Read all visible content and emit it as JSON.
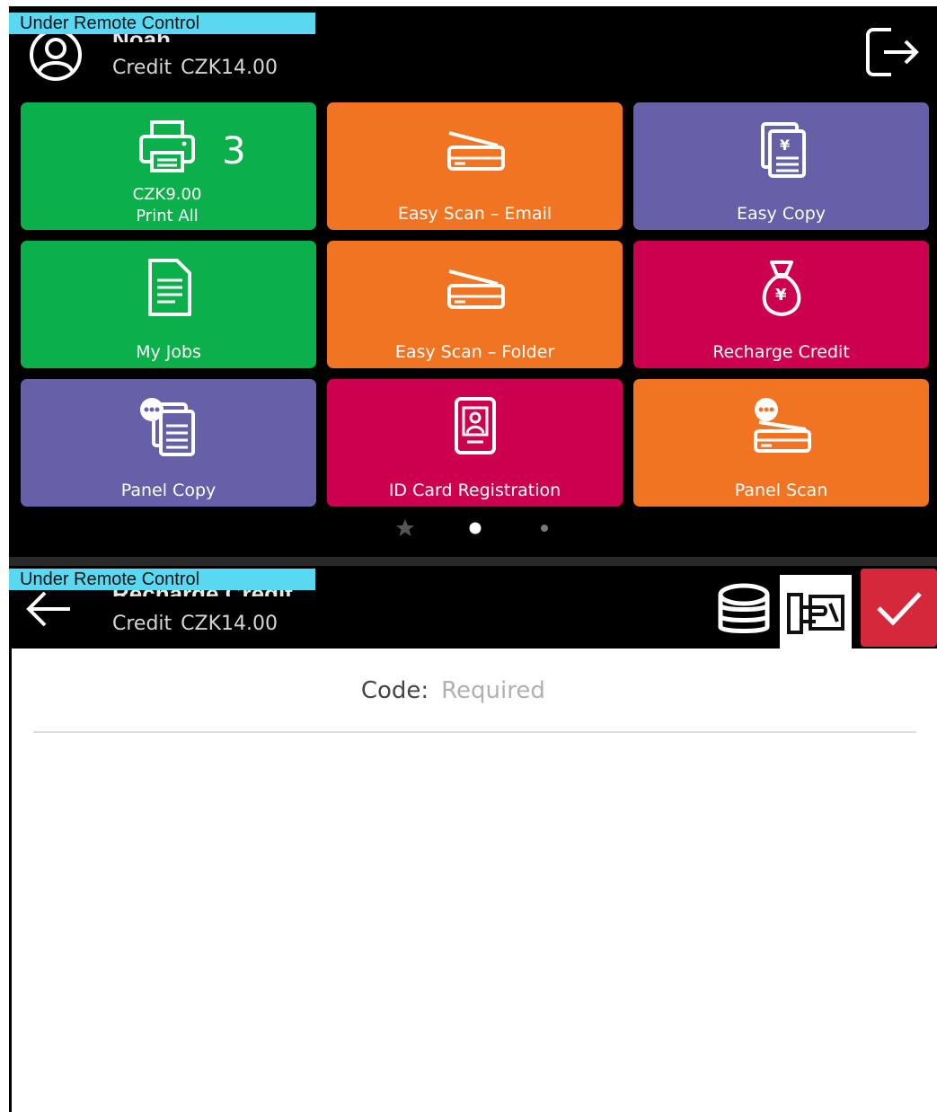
{
  "remote_banner": "Under Remote Control",
  "home": {
    "user_name": "Noah",
    "credit_label": "Credit",
    "credit_value": "CZK14.00",
    "tiles": [
      {
        "label": "Print All",
        "amount": "CZK9.00",
        "count": "3",
        "color": "#0cb04a",
        "icon": "printer-icon"
      },
      {
        "label": "Easy Scan – Email",
        "color": "#f07422",
        "icon": "scanner-icon"
      },
      {
        "label": "Easy Copy",
        "color": "#6560a8",
        "icon": "copy-document-icon"
      },
      {
        "label": "My Jobs",
        "color": "#0cb04a",
        "icon": "document-icon"
      },
      {
        "label": "Easy Scan – Folder",
        "color": "#f07422",
        "icon": "scanner-icon"
      },
      {
        "label": "Recharge Credit",
        "color": "#cc004e",
        "icon": "money-bag-icon"
      },
      {
        "label": "Panel Copy",
        "color": "#6560a8",
        "icon": "panel-copy-icon"
      },
      {
        "label": "ID Card Registration",
        "color": "#cc004e",
        "icon": "id-card-icon"
      },
      {
        "label": "Panel Scan",
        "color": "#f07422",
        "icon": "panel-scan-icon"
      }
    ],
    "pager": {
      "pages": 3,
      "active": 1
    }
  },
  "recharge": {
    "title": "Recharge Credit",
    "credit_label": "Credit",
    "credit_value": "CZK14.00",
    "code_label": "Code:",
    "code_placeholder": "Required",
    "code_value": "",
    "confirm_color": "#d6283b"
  }
}
